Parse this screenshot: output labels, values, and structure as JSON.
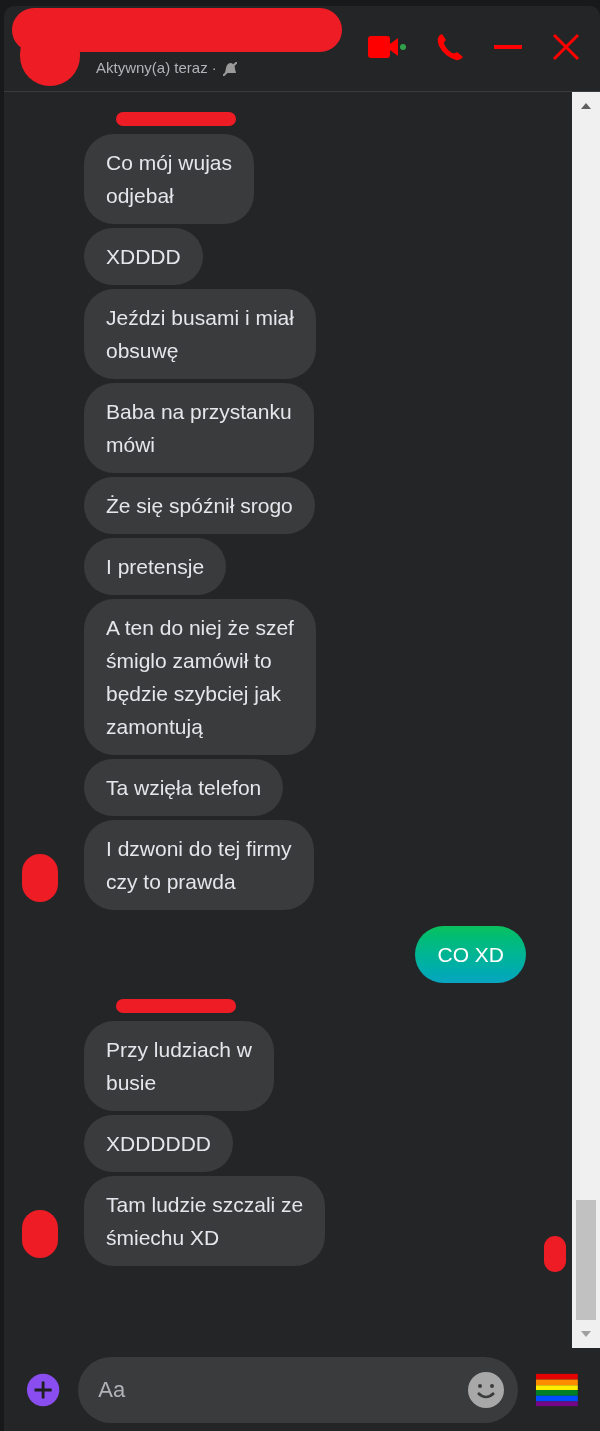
{
  "header": {
    "status": "Aktywny(a) teraz ·"
  },
  "groups": [
    {
      "kind": "incoming",
      "messages": [
        "Co mój wujas\nodjebał",
        "XDDDD",
        "Jeździ busami i miał\nobsuwę",
        "Baba na przystanku\nmówi",
        "Że się spóźnił srogo",
        "I pretensje",
        "A ten do niej że szef\nśmiglo zamówił to\nbędzie szybciej jak\nzamontują",
        "Ta wzięła telefon",
        "I dzwoni do tej firmy\nczy to prawda"
      ]
    },
    {
      "kind": "outgoing",
      "messages": [
        "CO XD"
      ]
    },
    {
      "kind": "incoming",
      "messages": [
        "Przy ludziach w\nbusie",
        "XDDDDDD",
        "Tam ludzie szczali ze\nśmiechu XD"
      ]
    }
  ],
  "composer": {
    "placeholder": "Aa"
  }
}
